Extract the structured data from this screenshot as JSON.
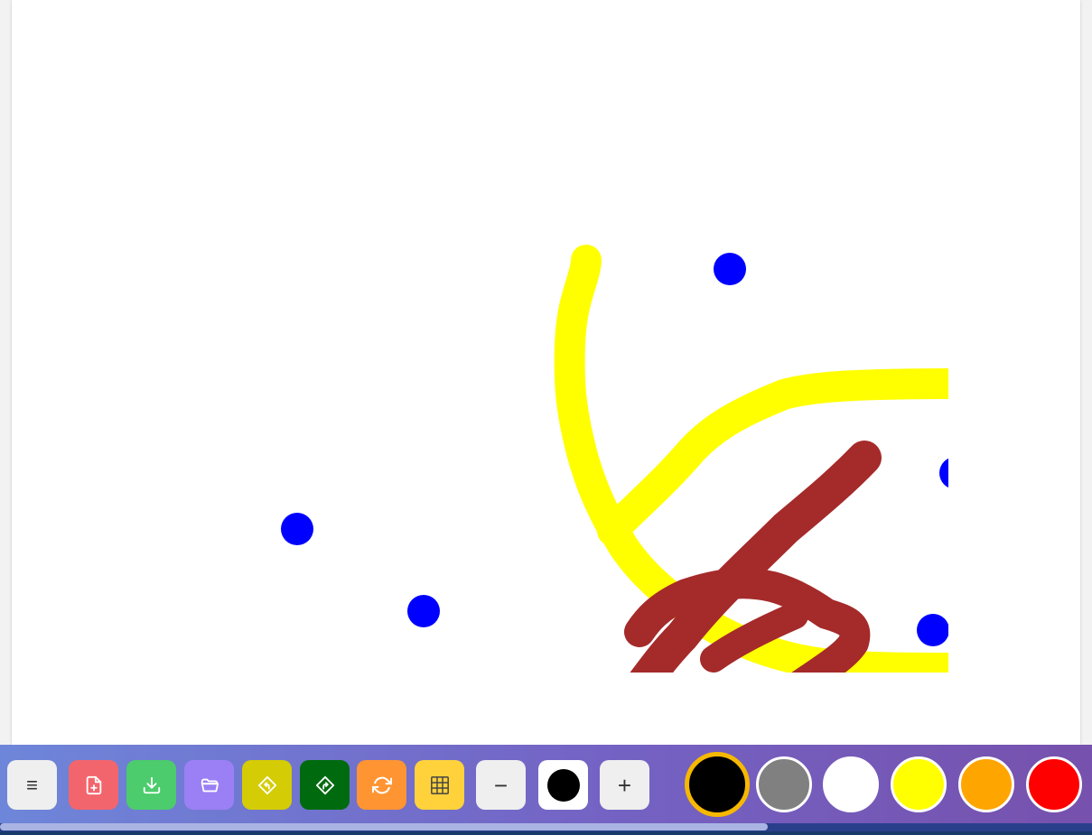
{
  "app": {
    "canvas_background": "#ffffff"
  },
  "toolbar": {
    "buttons": [
      {
        "name": "menu-button",
        "icon": "menu-icon",
        "label": "≡",
        "color": "#efefef"
      },
      {
        "name": "new-page-button",
        "icon": "file-plus-icon",
        "color": "#f3656c"
      },
      {
        "name": "download-button",
        "icon": "download-icon",
        "color": "#4ccc6c"
      },
      {
        "name": "open-folder-button",
        "icon": "folder-icon",
        "color": "#9b7ff5"
      },
      {
        "name": "undo-button",
        "icon": "turn-left-icon",
        "color": "#d4cc05"
      },
      {
        "name": "redo-button",
        "icon": "turn-right-icon",
        "color": "#006b0e"
      },
      {
        "name": "refresh-button",
        "icon": "refresh-icon",
        "color": "#ff9532"
      },
      {
        "name": "grid-button",
        "icon": "grid-icon",
        "color": "#ffd23c"
      }
    ],
    "brush_size": {
      "decrease_label": "−",
      "increase_label": "+",
      "preview_color": "#000000"
    },
    "palette": {
      "selected": "#000000",
      "selected_ring": "#f6b800",
      "colors": [
        "#000000",
        "#808080",
        "#ffffff",
        "#ffff00",
        "#ffa500",
        "#ff0000"
      ]
    }
  },
  "drawing": {
    "stroke_colors": {
      "yellow": "#ffff00",
      "brown": "#a52a2a",
      "blue": "#0000ff"
    }
  }
}
